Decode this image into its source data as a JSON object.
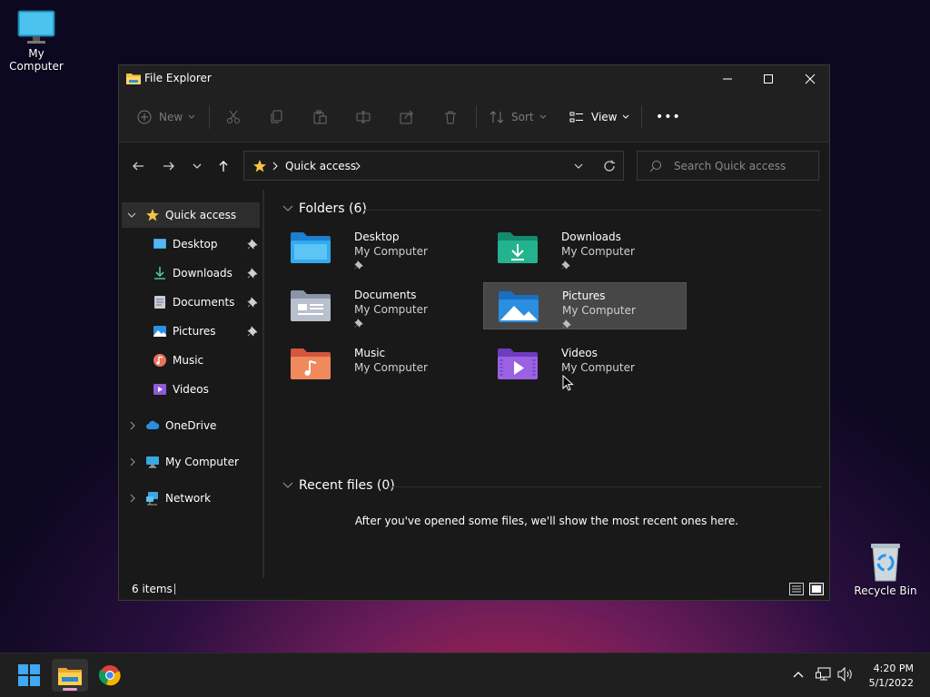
{
  "desktop": {
    "my_computer_label": "My Computer",
    "recycle_bin_label": "Recycle Bin"
  },
  "window": {
    "title": "File Explorer",
    "minimize": "–",
    "maximize": "☐",
    "close": "✕"
  },
  "toolbar": {
    "new_label": "New",
    "sort_label": "Sort",
    "view_label": "View",
    "more_label": "•••"
  },
  "address": {
    "location": "Quick access",
    "search_placeholder": "Search Quick access"
  },
  "sidebar": {
    "quick_access": "Quick access",
    "items": [
      {
        "label": "Desktop",
        "pinned": true
      },
      {
        "label": "Downloads",
        "pinned": true
      },
      {
        "label": "Documents",
        "pinned": true
      },
      {
        "label": "Pictures",
        "pinned": true
      },
      {
        "label": "Music",
        "pinned": false
      },
      {
        "label": "Videos",
        "pinned": false
      }
    ],
    "onedrive": "OneDrive",
    "my_computer": "My Computer",
    "network": "Network"
  },
  "content": {
    "folders_header": "Folders (6)",
    "folders": [
      {
        "name": "Desktop",
        "location": "My Computer",
        "pinned": true
      },
      {
        "name": "Downloads",
        "location": "My Computer",
        "pinned": true
      },
      {
        "name": "Documents",
        "location": "My Computer",
        "pinned": true
      },
      {
        "name": "Pictures",
        "location": "My Computer",
        "pinned": true
      },
      {
        "name": "Music",
        "location": "My Computer",
        "pinned": false
      },
      {
        "name": "Videos",
        "location": "My Computer",
        "pinned": false
      }
    ],
    "recent_header": "Recent files (0)",
    "recent_empty_message": "After you've opened some files, we'll show the most recent ones here."
  },
  "status": {
    "item_count": "6 items"
  },
  "taskbar": {
    "time": "4:20 PM",
    "date": "5/1/2022"
  },
  "colors": {
    "accent": "#60cdff",
    "folder_yellow": "#f6c343"
  }
}
